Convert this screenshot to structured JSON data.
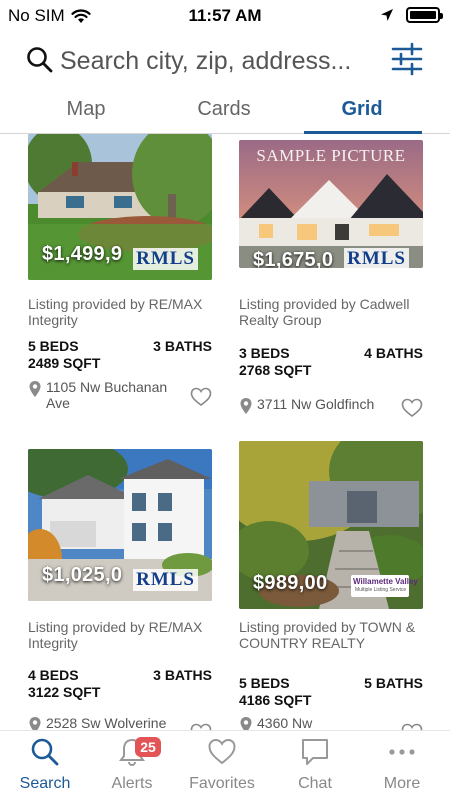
{
  "status": {
    "carrier": "No SIM",
    "time": "11:57 AM"
  },
  "search": {
    "placeholder": "Search city, zip, address..."
  },
  "tabs": [
    {
      "label": "Map",
      "active": false
    },
    {
      "label": "Cards",
      "active": false
    },
    {
      "label": "Grid",
      "active": true
    }
  ],
  "listings": [
    {
      "price": "$1,499,9",
      "logo": "RMLS",
      "provided_by": "Listing provided by RE/MAX Integrity",
      "beds": "5 BEDS",
      "baths": "3 BATHS",
      "sqft": "2489 SQFT",
      "address": "1105 Nw Buchanan Ave"
    },
    {
      "price": "$1,675,0",
      "logo": "RMLS",
      "overlay_text": "SAMPLE PICTURE",
      "provided_by": "Listing provided by Cadwell Realty Group",
      "beds": "3 BEDS",
      "baths": "4 BATHS",
      "sqft": "2768 SQFT",
      "address": "3711 Nw Goldfinch"
    },
    {
      "price": "$1,025,0",
      "logo": "RMLS",
      "provided_by": "Listing provided by RE/MAX Integrity",
      "beds": "4 BEDS",
      "baths": "3 BATHS",
      "sqft": "3122 SQFT",
      "address": "2528 Sw Wolverine"
    },
    {
      "price": "$989,00",
      "logo": "Willamette Valley",
      "logo_subtext": "Multiple Listing Service",
      "provided_by": "Listing provided by TOWN & COUNTRY REALTY",
      "beds": "5 BEDS",
      "baths": "5 BATHS",
      "sqft": "4186 SQFT",
      "address": "4360 Nw"
    }
  ],
  "nav": [
    {
      "label": "Search",
      "icon": "search-icon",
      "active": true
    },
    {
      "label": "Alerts",
      "icon": "bell-icon",
      "badge": "25"
    },
    {
      "label": "Favorites",
      "icon": "heart-icon"
    },
    {
      "label": "Chat",
      "icon": "chat-icon"
    },
    {
      "label": "More",
      "icon": "more-dots-icon"
    }
  ],
  "colors": {
    "accent": "#1b5a96",
    "badge": "#e25456"
  }
}
